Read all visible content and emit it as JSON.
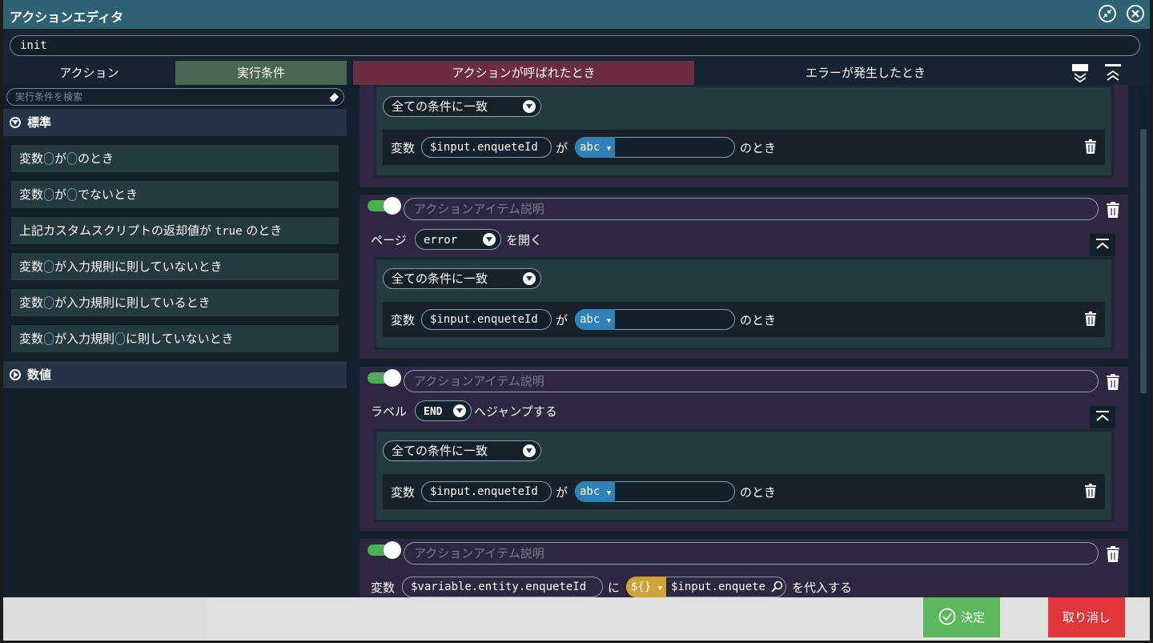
{
  "window": {
    "title": "アクションエディタ"
  },
  "action_name": "init",
  "tabs": {
    "action": "アクション",
    "conditions": "実行条件",
    "when_called": "アクションが呼ばれたとき",
    "when_error": "エラーが発生したとき"
  },
  "sidebar": {
    "search_placeholder": "実行条件を検索",
    "groups": [
      {
        "label": "標準"
      },
      {
        "label": "数値"
      }
    ],
    "items": [
      {
        "p1": "変数",
        "p2": "が",
        "p3": "のとき"
      },
      {
        "p1": "変数",
        "p2": "が",
        "p3": "でないとき"
      },
      {
        "p1": "上記カスタムスクリプトの返却値が",
        "code": "true",
        "p3": "のとき"
      },
      {
        "p1": "変数",
        "p2": "が入力規則に則していないとき"
      },
      {
        "p1": "変数",
        "p2": "が入力規則に則しているとき"
      },
      {
        "p1": "変数",
        "p2": "が入力規則",
        "p3": "に則していないとき"
      }
    ]
  },
  "main": {
    "cond_mode": "全ての条件に一致",
    "cond_var_label": "変数",
    "cond_var": "$input.enqueteId",
    "cond_ga": "が",
    "cond_type": "abc",
    "cond_suffix": "のとき",
    "desc_placeholder": "アクションアイテム説明",
    "item_page": {
      "prefix": "ページ",
      "page": "error",
      "suffix": "を開く"
    },
    "item_jump": {
      "prefix": "ラベル",
      "label": "END",
      "suffix": "へジャンプする"
    },
    "item_assign": {
      "prefix": "変数",
      "var": "$variable.entity.enqueteId",
      "ni": "に",
      "type": "${}",
      "value": "$input.enquete",
      "suffix": "を代入する"
    }
  },
  "footer": {
    "ok": "決定",
    "cancel": "取り消し"
  },
  "colors": {
    "titlebar": "#2d6272",
    "tab_conditions": "#4a6650",
    "tab_called": "#6b2d3f",
    "action_item_bg": "#2f2742",
    "condition_block_bg": "#233a40",
    "toggle_on": "#4caf50",
    "type_abc": "#2e82b8",
    "type_expr": "#d0a33a",
    "ok_button": "#5cb85c",
    "cancel_button": "#e0363a"
  }
}
